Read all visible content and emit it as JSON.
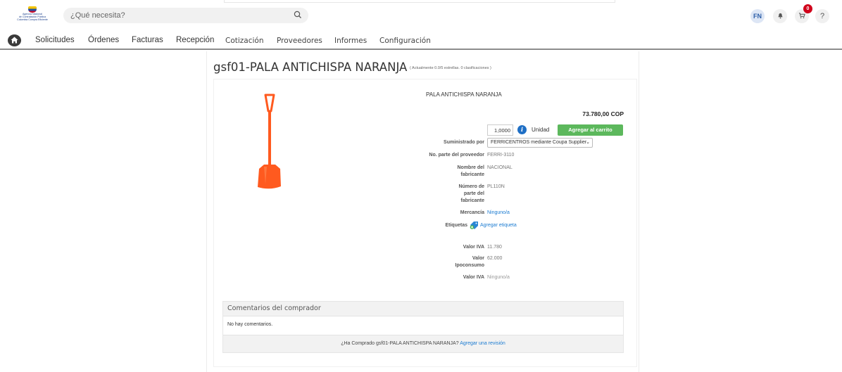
{
  "header": {
    "logo_text": [
      "Agencia Nacional",
      "de Contratación Pública",
      "Colombia Compra Eficiente"
    ],
    "search_placeholder": "¿Qué necesita?",
    "user_initials": "FN",
    "cart_count": "0",
    "help_label": "?"
  },
  "nav": {
    "items": [
      "Solicitudes",
      "Órdenes",
      "Facturas",
      "Recepción",
      "Cotización",
      "Proveedores",
      "Informes",
      "Configuración"
    ]
  },
  "product": {
    "title": "gsf01-PALA ANTICHISPA NARANJA",
    "rating": "( Actualmente 0.0/5 estrellas. 0 clasificaciones )",
    "name": "PALA ANTICHISPA NARANJA",
    "price": "73.780,00 COP",
    "quantity": "1,0000",
    "unit": "Unidad",
    "add_to_cart": "Agregar al carrito",
    "image_color": "#ff5a1f"
  },
  "fields": {
    "supplied_by_label": "Suministrado por",
    "supplied_by_value": "FERRICENTROS mediante Coupa Supplier",
    "supplier_part_label": "No. parte del proveedor",
    "supplier_part_value": "FERRI-3110",
    "manufacturer_label_1": "Nombre del",
    "manufacturer_label_2": "fabricante",
    "manufacturer_value": "NACIONAL",
    "mfr_part_label_1": "Número de",
    "mfr_part_label_2": "parte del",
    "mfr_part_label_3": "fabricante",
    "mfr_part_value": "PL110N",
    "commodity_label": "Mercancía",
    "commodity_value": "Ninguno/a",
    "tags_label": "Etiquetas",
    "tags_value": "Agregar etiqueta",
    "iva_label": "Valor IVA",
    "iva_value": "11.780",
    "ipoconsumo_label_1": "Valor",
    "ipoconsumo_label_2": "Ipoconsumo",
    "ipoconsumo_value": "62.000",
    "iva2_label": "Valor IVA",
    "iva2_value": "Ninguno/a"
  },
  "comments": {
    "title": "Comentarios del comprador",
    "empty": "No hay comentarios.",
    "question": "¿Ha Comprado gsf01-PALA ANTICHISPA NARANJA?",
    "review_link": "Agregar una revisión"
  },
  "colors": {
    "accent_green": "#5cb85c",
    "link_blue": "#1b7bd1",
    "badge_red": "#d0021b"
  }
}
